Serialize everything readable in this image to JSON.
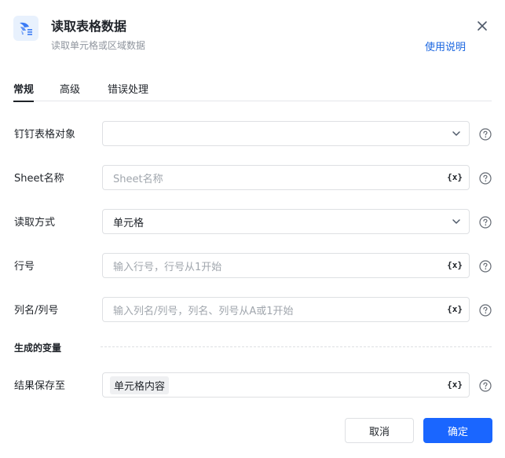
{
  "dialog": {
    "title": "读取表格数据",
    "subtitle": "读取单元格或区域数据",
    "help_link": "使用说明"
  },
  "tabs": [
    {
      "label": "常规",
      "active": true
    },
    {
      "label": "高级",
      "active": false
    },
    {
      "label": "错误处理",
      "active": false
    }
  ],
  "fields": {
    "dingtalk_sheet": {
      "label": "钉钉表格对象",
      "value": "",
      "icon": "chevron-down-icon"
    },
    "sheet_name": {
      "label": "Sheet名称",
      "placeholder": "Sheet名称",
      "icon": "variable-icon"
    },
    "read_mode": {
      "label": "读取方式",
      "value": "单元格",
      "icon": "chevron-down-icon"
    },
    "row": {
      "label": "行号",
      "placeholder": "输入行号，行号从1开始",
      "icon": "variable-icon"
    },
    "column": {
      "label": "列名/列号",
      "placeholder": "输入列名/列号，列名、列号从A或1开始",
      "icon": "variable-icon"
    }
  },
  "variable_icon_text": "{x}",
  "output_section": {
    "title": "生成的变量",
    "result_label": "结果保存至",
    "result_value": "单元格内容"
  },
  "footer": {
    "cancel_label": "取消",
    "ok_label": "确定"
  },
  "colors": {
    "primary": "#1a66ff",
    "link": "#1a66e0",
    "text": "#1f2329",
    "placeholder": "#a0a6ad"
  }
}
